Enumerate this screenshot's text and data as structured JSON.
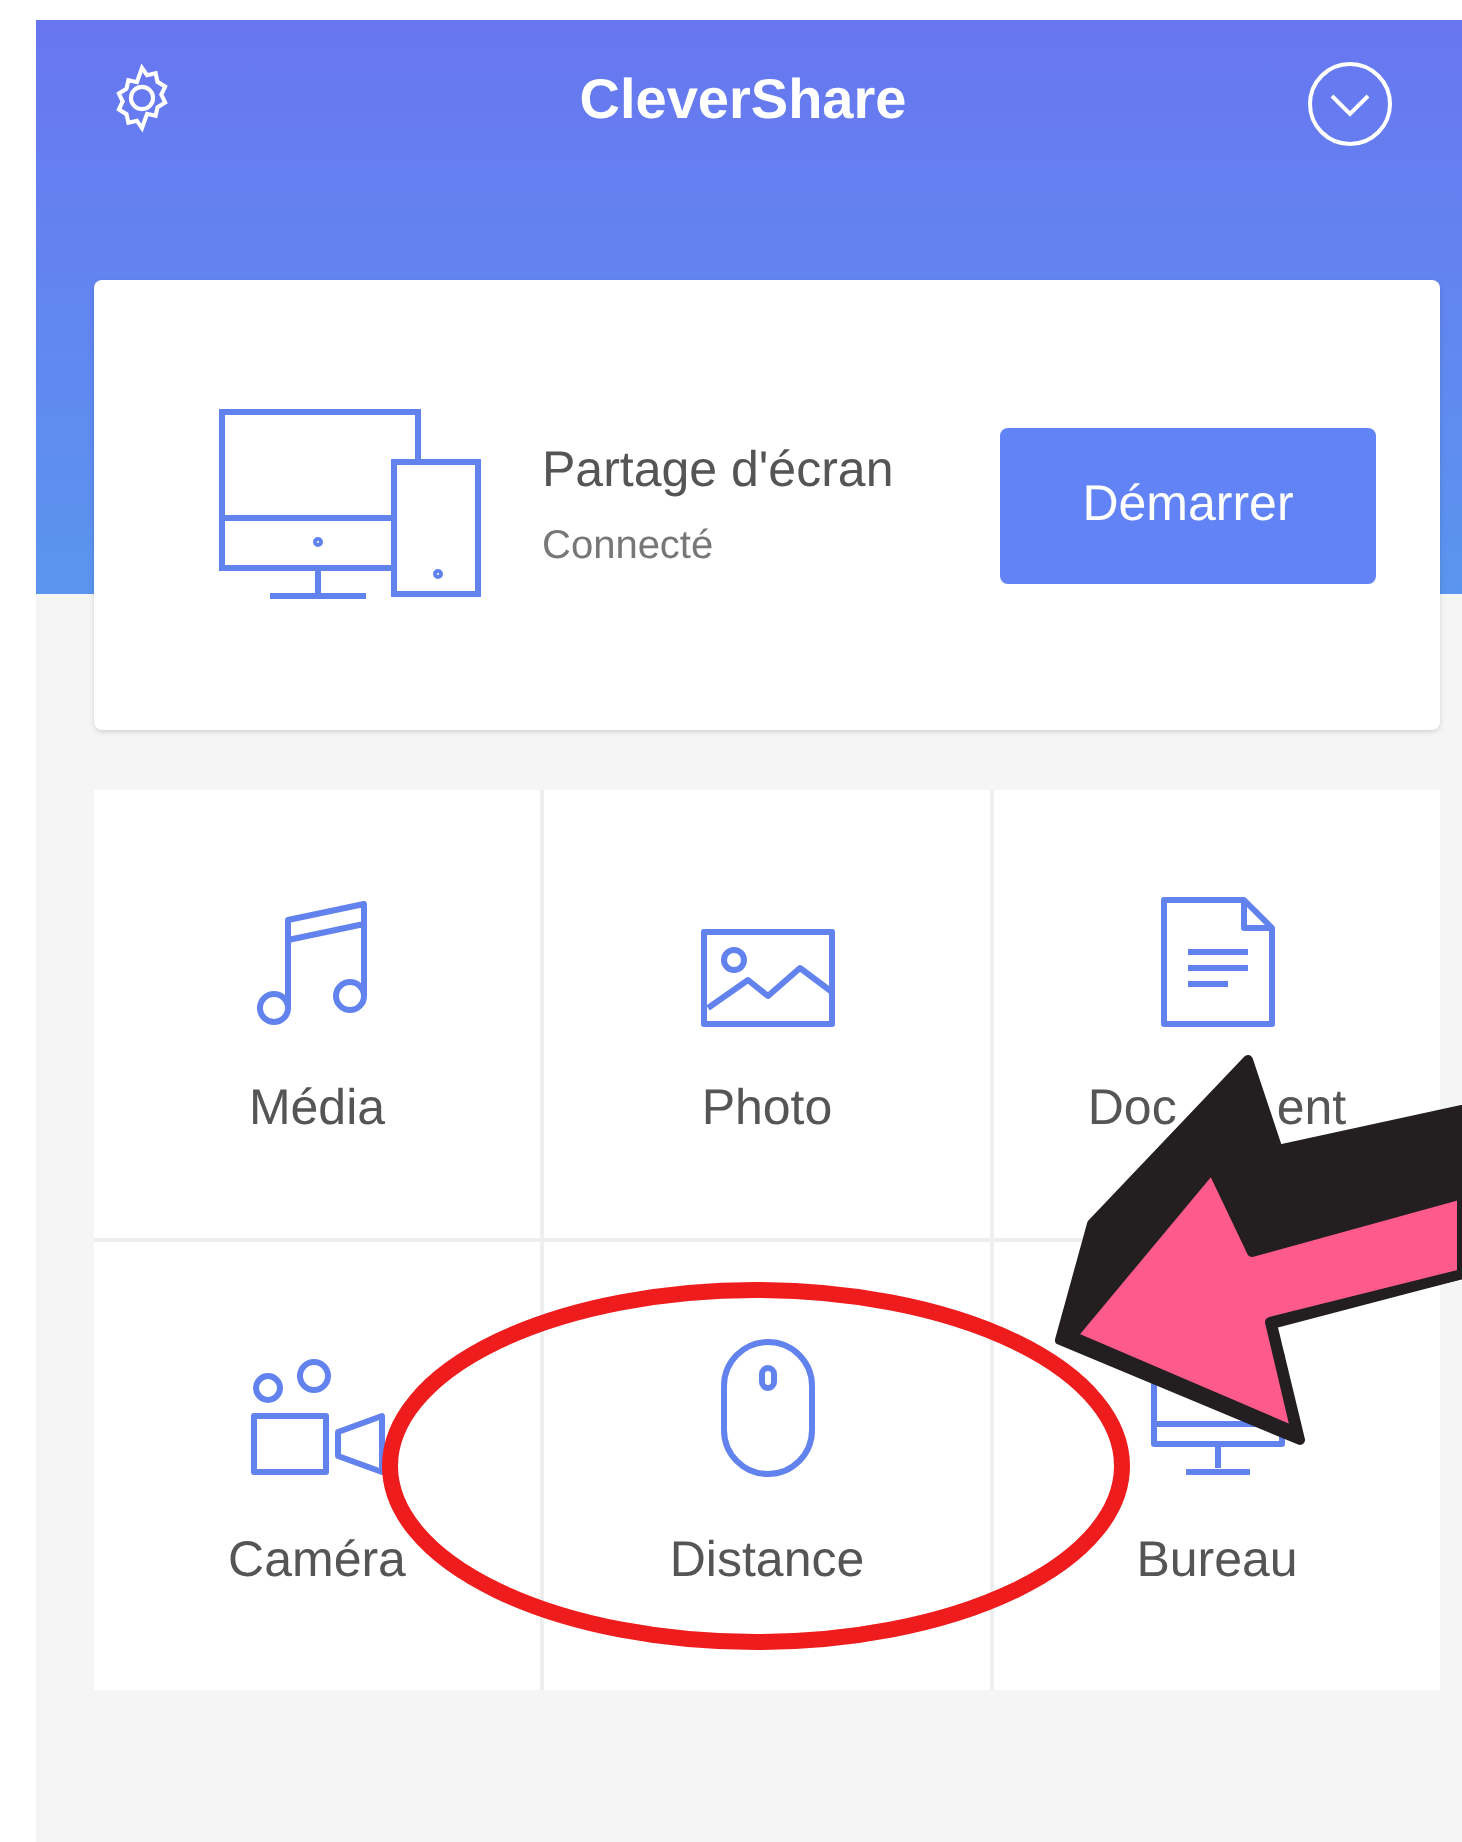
{
  "header": {
    "title": "CleverShare"
  },
  "share_card": {
    "title": "Partage d'écran",
    "status": "Connecté",
    "button": "Démarrer"
  },
  "features": [
    {
      "kind": "music",
      "label": "Média"
    },
    {
      "kind": "photo",
      "label": "Photo"
    },
    {
      "kind": "document",
      "label": "Doc",
      "label_tail": "ent"
    },
    {
      "kind": "camera",
      "label": "Caméra"
    },
    {
      "kind": "mouse",
      "label": "Distance"
    },
    {
      "kind": "desktop",
      "label": "Bureau"
    }
  ]
}
